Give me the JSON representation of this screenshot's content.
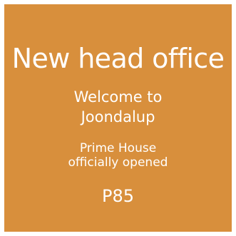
{
  "tile": {
    "background_color": "#d88f3c",
    "text_color": "#ffffff",
    "headline": "New head office",
    "subhead_line1": "Welcome to",
    "subhead_line2": "Joondalup",
    "blurb_line1": "Prime House",
    "blurb_line2": "officially opened",
    "page_ref": "P85"
  }
}
